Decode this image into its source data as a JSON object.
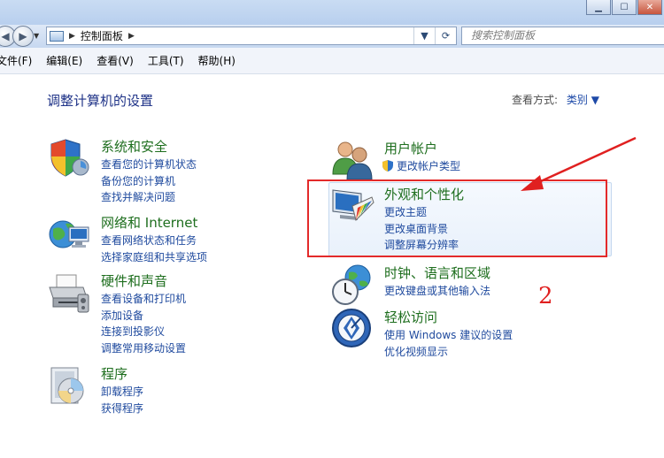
{
  "window": {
    "buttons": [
      "minimize",
      "maximize",
      "close"
    ]
  },
  "nav": {
    "breadcrumb_root": "控制面板",
    "search_placeholder": "搜索控制面板"
  },
  "menu": {
    "items": [
      "文件(F)",
      "编辑(E)",
      "查看(V)",
      "工具(T)",
      "帮助(H)"
    ]
  },
  "page": {
    "heading": "调整计算机的设置",
    "view_by_label": "查看方式:",
    "view_by_value": "类别 ▼"
  },
  "categories": {
    "system_security": {
      "title": "系统和安全",
      "links": [
        "查看您的计算机状态",
        "备份您的计算机",
        "查找并解决问题"
      ],
      "icon": "shield-icon"
    },
    "network": {
      "title": "网络和 Internet",
      "links": [
        "查看网络状态和任务",
        "选择家庭组和共享选项"
      ],
      "icon": "network-globe-icon"
    },
    "hardware": {
      "title": "硬件和声音",
      "links": [
        "查看设备和打印机",
        "添加设备",
        "连接到投影仪",
        "调整常用移动设置"
      ],
      "icon": "printer-icon"
    },
    "programs": {
      "title": "程序",
      "links": [
        "卸载程序",
        "获得程序"
      ],
      "icon": "programs-disc-icon"
    },
    "user_accounts": {
      "title": "用户帐户",
      "links": [
        "更改帐户类型"
      ],
      "icon": "users-icon"
    },
    "appearance": {
      "title": "外观和个性化",
      "links": [
        "更改主题",
        "更改桌面背景",
        "调整屏幕分辨率"
      ],
      "icon": "monitor-palette-icon"
    },
    "clock": {
      "title": "时钟、语言和区域",
      "links": [
        "更改键盘或其他输入法"
      ],
      "icon": "clock-globe-icon"
    },
    "ease": {
      "title": "轻松访问",
      "links": [
        "使用 Windows 建议的设置",
        "优化视频显示"
      ],
      "icon": "ease-of-access-icon"
    }
  },
  "annotation": {
    "number": "2",
    "color": "#e02020"
  }
}
